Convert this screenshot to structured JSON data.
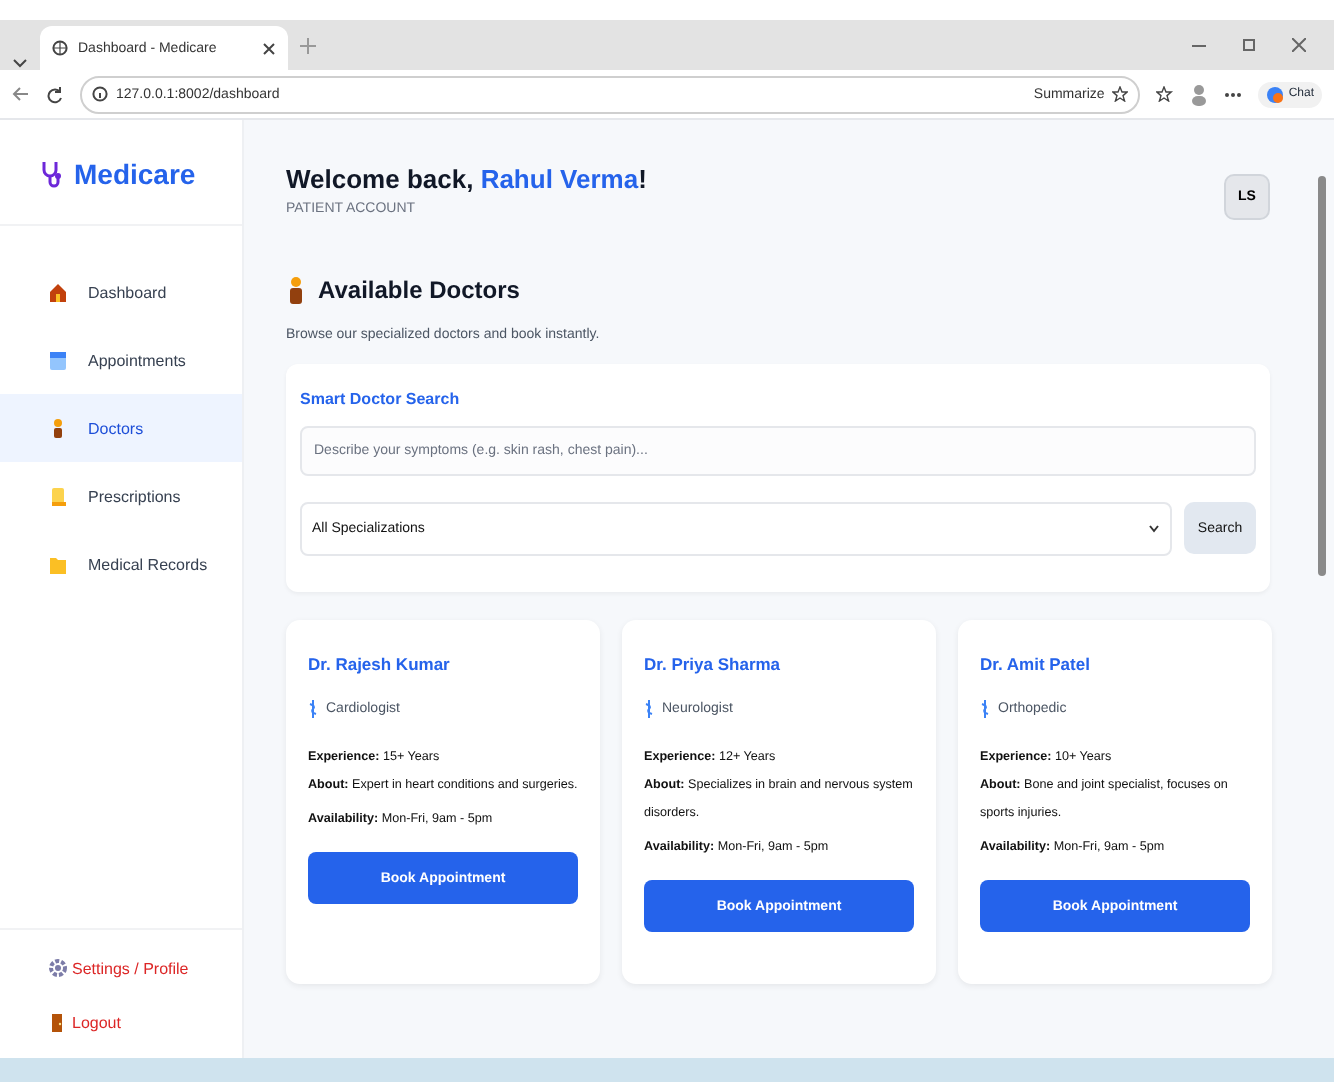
{
  "browser": {
    "tab_title": "Dashboard - Medicare",
    "url": "127.0.0.1:8002/dashboard",
    "summarize": "Summarize",
    "chat": "Chat"
  },
  "sidebar": {
    "logo": "Medicare",
    "items": [
      {
        "label": "Dashboard",
        "selected": false
      },
      {
        "label": "Appointments",
        "selected": false
      },
      {
        "label": "Doctors",
        "selected": true
      },
      {
        "label": "Prescriptions",
        "selected": false
      },
      {
        "label": "Medical Records",
        "selected": false
      }
    ],
    "footer": [
      {
        "label": "Settings / Profile"
      },
      {
        "label": "Logout"
      }
    ]
  },
  "header": {
    "greeting": "Welcome back, ",
    "user": "Rahul Verma",
    "exclaim": "!",
    "role": "PATIENT ACCOUNT",
    "avatar": "LS"
  },
  "section": {
    "title": "Available Doctors",
    "subtitle": "Browse our specialized doctors and book instantly."
  },
  "search": {
    "title": "Smart Doctor Search",
    "placeholder": "Describe your symptoms (e.g. skin rash, chest pain)...",
    "select": "All Specializations",
    "button": "Search"
  },
  "doctors": [
    {
      "name": "Dr. Rajesh Kumar",
      "specialty": "Cardiologist",
      "experience": "**Experience:** 15+ Years",
      "about": "**About:** Expert in heart conditions and surgeries.",
      "availability": "**Availability:** Mon-Fri, 9am - 5pm",
      "button": "Book Appointment"
    },
    {
      "name": "Dr. Priya Sharma",
      "specialty": "Neurologist",
      "experience": "**Experience:** 12+ Years",
      "about": "**About:** Specializes in brain and nervous system disorders.",
      "availability": "**Availability:** Mon-Fri, 9am - 5pm",
      "button": "Book Appointment"
    },
    {
      "name": "Dr. Amit Patel",
      "specialty": "Orthopedic",
      "experience": "**Experience:** 10+ Years",
      "about": "**About:** Bone and joint specialist, focuses on sports injuries.",
      "availability": "**Availability:** Mon-Fri, 9am - 5pm",
      "button": "Book Appointment"
    }
  ]
}
